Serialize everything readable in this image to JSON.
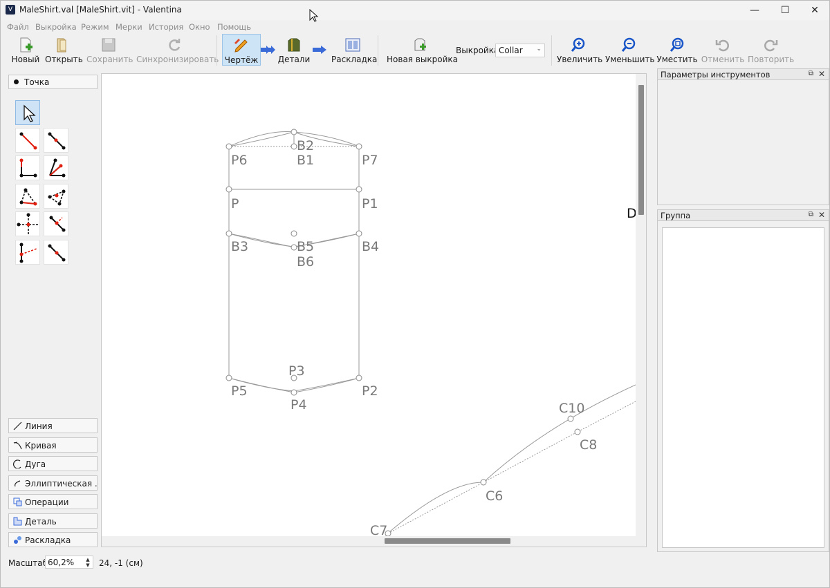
{
  "window": {
    "title": "MaleShirt.val [MaleShirt.vit] - Valentina",
    "minimize": "—",
    "maximize": "☐",
    "close": "✕"
  },
  "menu": [
    "Файл",
    "Выкройка",
    "Режим",
    "Мерки",
    "История",
    "Окно",
    "Помощь"
  ],
  "toolbar": {
    "new": "Новый",
    "open": "Открыть",
    "save": "Сохранить",
    "sync": "Синхронизировать",
    "draw": "Чертёж",
    "details": "Детали",
    "layout": "Раскладка",
    "new_pattern": "Новая выкройка",
    "pattern_label": "Выкройка:",
    "pattern_value": "Collar",
    "zoom_in": "Увеличить",
    "zoom_out": "Уменьшить",
    "fit": "Уместить",
    "undo": "Отменить",
    "redo": "Повторить"
  },
  "tools": {
    "header": "Точка",
    "categories": [
      "Линия",
      "Кривая",
      "Дуга",
      "Эллиптическая ...",
      "Операции",
      "Деталь",
      "Раскладка"
    ]
  },
  "canvas": {
    "points": {
      "B2": "B2",
      "B1": "B1",
      "P6": "P6",
      "P7": "P7",
      "P": "P",
      "P1": "P1",
      "B3": "B3",
      "B5": "B5",
      "B6": "B6",
      "B4": "B4",
      "P3": "P3",
      "P5": "P5",
      "P4": "P4",
      "P2": "P2",
      "C10": "C10",
      "C8": "C8",
      "C6": "C6",
      "C7": "C7",
      "D": "D"
    }
  },
  "docks": {
    "tool_options": "Параметры инструментов",
    "group": "Группа"
  },
  "status": {
    "zoom_label": "Масштаб:",
    "zoom_value": "60,2%",
    "coords": "24, -1 (см)"
  }
}
